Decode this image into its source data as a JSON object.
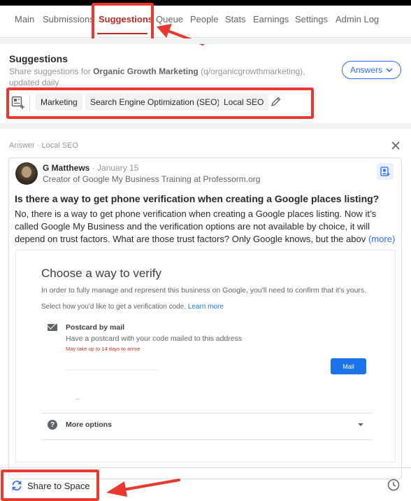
{
  "nav": {
    "tabs": [
      {
        "label": "Main"
      },
      {
        "label": "Submissions"
      },
      {
        "label": "Suggestions",
        "active": true
      },
      {
        "label": "Queue"
      },
      {
        "label": "People"
      },
      {
        "label": "Stats"
      },
      {
        "label": "Earnings"
      },
      {
        "label": "Settings"
      },
      {
        "label": "Admin Log"
      }
    ]
  },
  "suggestions": {
    "title": "Suggestions",
    "desc_prefix": "Share suggestions for ",
    "space_name": "Organic Growth Marketing",
    "desc_suffix": " (q/organicgrowthmarketing), updated daily",
    "answers_button": "Answers",
    "topics": [
      "Marketing",
      "Search Engine Optimization (SEO)",
      "Local SEO"
    ]
  },
  "answer": {
    "label": "Answer · Local SEO",
    "author": "G Matthews",
    "date": "· January 15",
    "credential": "Creator of Google My Business Training at Professorm.org",
    "question": "Is there a way to get phone verification when creating a Google places listing?",
    "body": "No, there is a way to get phone verification when creating a Google places listing. Now it’s called Google My Business and the verification options are not available by choice, it will depend on trust factors. What are those trust factors? Only Google knows, but the above",
    "more_link": "(more)",
    "embedded": {
      "title": "Choose a way to verify",
      "desc": "In order to fully manage and represent this business on Google, you'll need to confirm that it's yours.",
      "sub": "Select how you'd like to get a verification code.",
      "learn_more": "Learn more",
      "option_title": "Postcard by mail",
      "option_desc": "Have a postcard with your code mailed to this address",
      "option_warn": "May take up to 14 days to arrive",
      "mail_button": "Mail",
      "more_options": "More options"
    }
  },
  "footer": {
    "share_label": "Share to Space"
  },
  "colors": {
    "accent_red": "#b92b27",
    "highlight_red": "#e8382f",
    "link_blue": "#2e69ff",
    "google_blue": "#1a73e8"
  }
}
